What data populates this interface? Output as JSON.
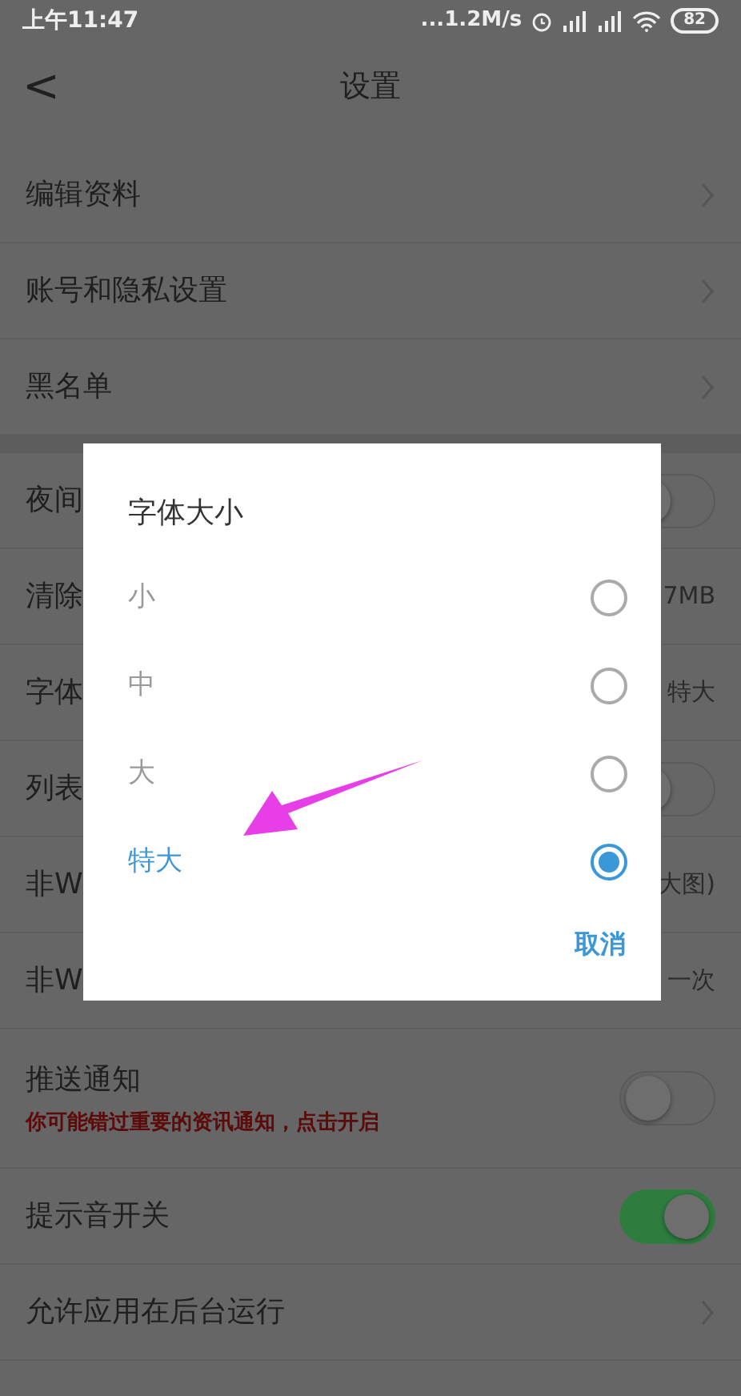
{
  "status_bar": {
    "time": "上午11:47",
    "speed": "...1.2M/s",
    "battery": "82"
  },
  "header": {
    "back": "<",
    "title": "设置"
  },
  "groups": [
    {
      "rows": [
        {
          "kind": "link",
          "label": "编辑资料"
        },
        {
          "kind": "link",
          "label": "账号和隐私设置"
        },
        {
          "kind": "link",
          "label": "黑名单"
        }
      ]
    },
    {
      "rows": [
        {
          "kind": "toggle",
          "label": "夜间",
          "on": false
        },
        {
          "kind": "value",
          "label": "清除",
          "value": "7MB"
        },
        {
          "kind": "value",
          "label": "字体",
          "value": "特大"
        },
        {
          "kind": "toggle",
          "label": "列表",
          "on": false
        },
        {
          "kind": "value",
          "label": "非W",
          "value": "大图)"
        },
        {
          "kind": "value",
          "label": "非W",
          "value": "一次"
        },
        {
          "kind": "toggle",
          "label": "推送通知",
          "subtitle": "你可能错过重要的资讯通知，点击开启",
          "on": false
        },
        {
          "kind": "toggle",
          "label": "提示音开关",
          "on": true
        },
        {
          "kind": "link",
          "label": "允许应用在后台运行"
        }
      ]
    }
  ],
  "dialog": {
    "title": "字体大小",
    "options": [
      {
        "label": "小",
        "selected": false
      },
      {
        "label": "中",
        "selected": false
      },
      {
        "label": "大",
        "selected": false
      },
      {
        "label": "特大",
        "selected": true
      }
    ],
    "cancel": "取消"
  }
}
